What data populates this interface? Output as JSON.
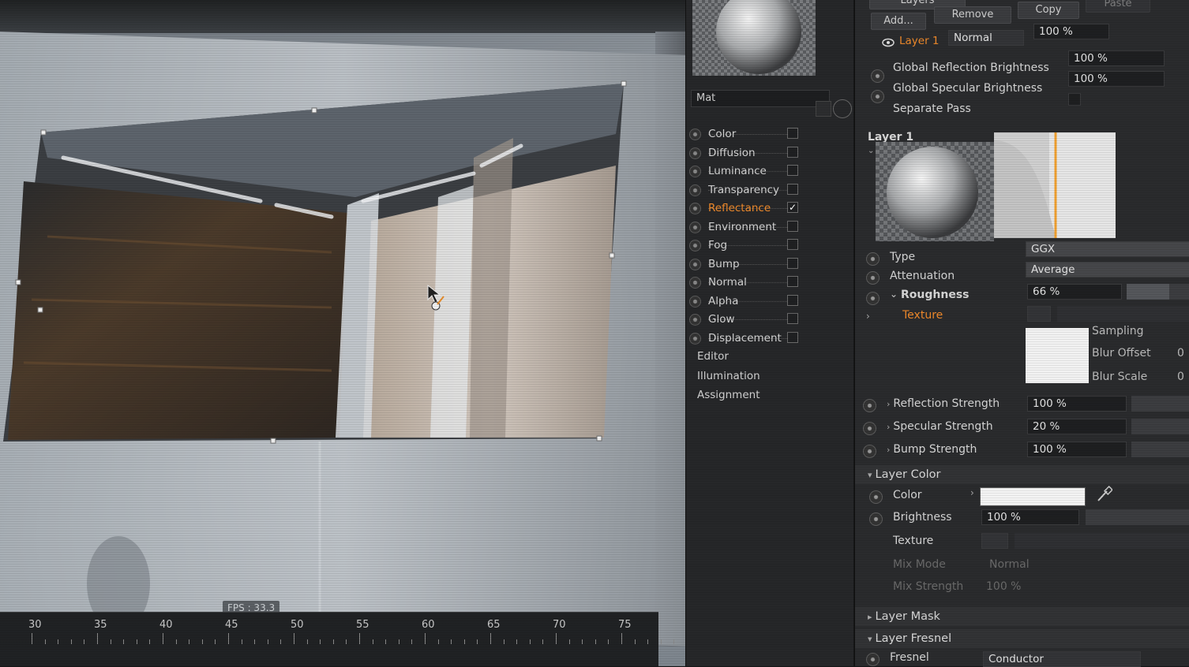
{
  "viewport": {
    "fps_label": "FPS : 33.3",
    "timeline_ticks": [
      "30",
      "35",
      "40",
      "45",
      "50",
      "55",
      "60",
      "65",
      "70",
      "75"
    ]
  },
  "material_panel": {
    "material_name": "Mat",
    "channels": [
      {
        "label": "Color",
        "checked": false,
        "active": false
      },
      {
        "label": "Diffusion",
        "checked": false,
        "active": false
      },
      {
        "label": "Luminance",
        "checked": false,
        "active": false
      },
      {
        "label": "Transparency",
        "checked": false,
        "active": false
      },
      {
        "label": "Reflectance",
        "checked": true,
        "active": true
      },
      {
        "label": "Environment",
        "checked": false,
        "active": false
      },
      {
        "label": "Fog",
        "checked": false,
        "active": false
      },
      {
        "label": "Bump",
        "checked": false,
        "active": false
      },
      {
        "label": "Normal",
        "checked": false,
        "active": false
      },
      {
        "label": "Alpha",
        "checked": false,
        "active": false
      },
      {
        "label": "Glow",
        "checked": false,
        "active": false
      },
      {
        "label": "Displacement",
        "checked": false,
        "active": false
      }
    ],
    "extra_items": [
      "Editor",
      "Illumination",
      "Assignment"
    ]
  },
  "attributes": {
    "tabs_label": "Layers",
    "buttons": {
      "add": "Add...",
      "remove": "Remove",
      "copy": "Copy",
      "paste": "Paste"
    },
    "layer_row": {
      "name": "Layer 1",
      "blend_mode": "Normal",
      "opacity": "100 %"
    },
    "global_reflection_label": "Global Reflection Brightness",
    "global_reflection_value": "100 %",
    "global_specular_label": "Global Specular Brightness",
    "global_specular_value": "100 %",
    "separate_pass_label": "Separate Pass",
    "layer_title": "Layer 1",
    "type_label": "Type",
    "type_value": "GGX",
    "attenuation_label": "Attenuation",
    "attenuation_value": "Average",
    "roughness_label": "Roughness",
    "roughness_value": "66 %",
    "roughness_fraction": 0.66,
    "texture_label": "Texture",
    "sampling_label": "Sampling",
    "blur_offset_label": "Blur Offset",
    "blur_offset_value": "0",
    "blur_scale_label": "Blur Scale",
    "blur_scale_value": "0",
    "reflection_strength_label": "Reflection Strength",
    "reflection_strength_value": "100 %",
    "specular_strength_label": "Specular Strength",
    "specular_strength_value": "20 %",
    "bump_strength_label": "Bump Strength",
    "bump_strength_value": "100 %",
    "layer_color_header": "Layer Color",
    "color_label": "Color",
    "brightness_label": "Brightness",
    "brightness_value": "100 %",
    "lc_texture_label": "Texture",
    "mix_mode_label": "Mix Mode",
    "mix_mode_value": "Normal",
    "mix_strength_label": "Mix Strength",
    "mix_strength_value": "100 %",
    "layer_mask_header": "Layer Mask",
    "layer_fresnel_header": "Layer Fresnel",
    "fresnel_label": "Fresnel",
    "fresnel_value": "Conductor",
    "accent_color": "#f08a2b"
  }
}
